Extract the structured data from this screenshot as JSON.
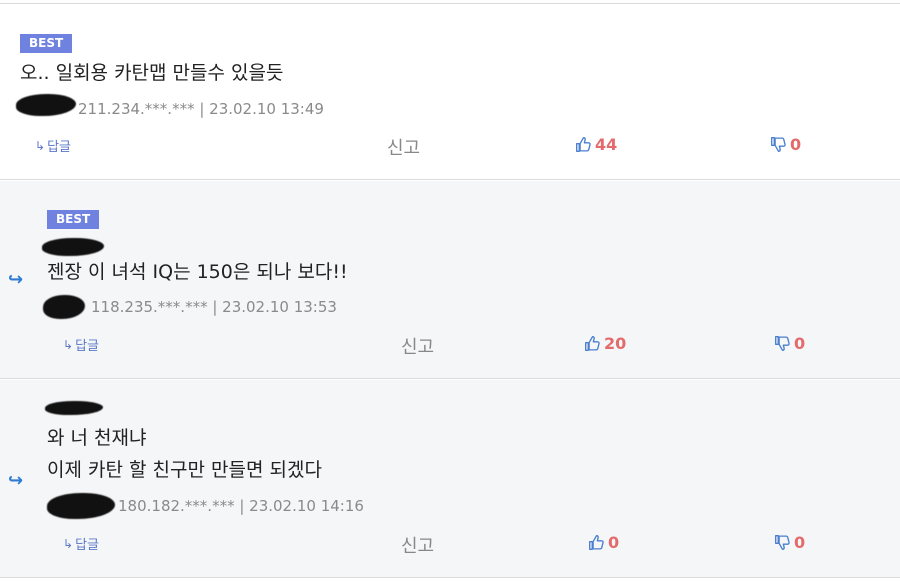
{
  "comments": [
    {
      "badge": "BEST",
      "lines": [
        "오.. 일회용 카탄맵 만들수 있을듯"
      ],
      "meta": "211.234.***.*** | 23.02.10 13:49",
      "reply_label": "답글",
      "report_label": "신고",
      "likes": "44",
      "dislikes": "0"
    },
    {
      "badge": "BEST",
      "lines": [
        "젠장 이 녀석 IQ는 150은 되나 보다!!"
      ],
      "meta": "118.235.***.*** | 23.02.10 13:53",
      "reply_label": "답글",
      "report_label": "신고",
      "likes": "20",
      "dislikes": "0"
    },
    {
      "badge": "",
      "lines": [
        "와 너 천재냐",
        "이제 카탄 할 친구만 만들면 되겠다"
      ],
      "meta": "180.182.***.*** | 23.02.10 14:16",
      "reply_label": "답글",
      "report_label": "신고",
      "likes": "0",
      "dislikes": "0"
    }
  ],
  "icons": {
    "reply_arrow": "reply-arrow-icon",
    "thumb_up": "thumbs-up-icon",
    "thumb_down": "thumbs-down-icon",
    "nested": "nested-reply-icon"
  },
  "colors": {
    "badge": "#6f82df",
    "vote_count": "#e36b6b",
    "reply_link": "#5b79c8",
    "nested_arrow": "#2f7bd4",
    "thumb_icon": "#4a7fd0"
  }
}
